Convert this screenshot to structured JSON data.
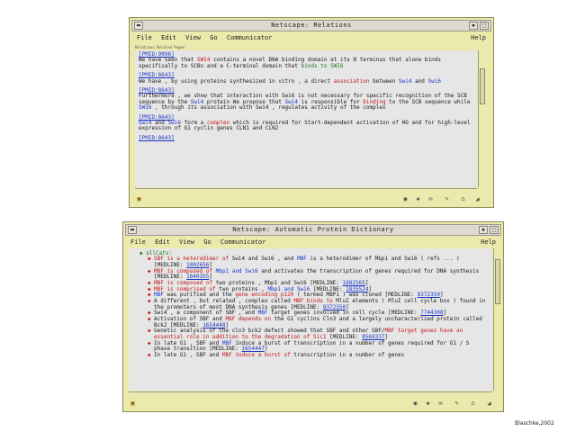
{
  "window1": {
    "title": "Netscape: Relations",
    "menu": [
      "File",
      "Edit",
      "View",
      "Go",
      "Communicator"
    ],
    "help": "Help",
    "strip": "Relations Related Pages",
    "paragraphs": [
      {
        "pmid": "[PMID:9096]",
        "segments": [
          {
            "text": "We have seen that "
          },
          {
            "text": "SWI4",
            "c": "red"
          },
          {
            "text": " contains a novel DNA binding domain at its N terminus that alone binds specifically to SCBs and a C-terminal domain that "
          },
          {
            "text": "binds to SWI6",
            "c": "green"
          }
        ]
      },
      {
        "pmid": "[PMID:8643]",
        "segments": [
          {
            "text": "We have , by using proteins synthesized in vitro , a direct "
          },
          {
            "text": "association",
            "c": "red"
          },
          {
            "text": " between "
          },
          {
            "text": "Swi4",
            "c": "blue"
          },
          {
            "text": " and "
          },
          {
            "text": "Swi6",
            "c": "blue"
          }
        ]
      },
      {
        "pmid": "[PMID:8643]",
        "segments": [
          {
            "text": "Furthermore , we show that interaction with Swi6 is not necessary for specific recognition of the SCB sequence by the "
          },
          {
            "text": "Swi4",
            "c": "blue"
          },
          {
            "text": " protein We propose that "
          },
          {
            "text": "Swi4",
            "c": "blue"
          },
          {
            "text": " is responsible for "
          },
          {
            "text": "binding",
            "c": "red"
          },
          {
            "text": " to the SCB sequence while "
          },
          {
            "text": "SWI6",
            "c": "blue"
          },
          {
            "text": " , through its association with Swi4 , regulates activity of the complex"
          }
        ]
      },
      {
        "pmid": "[PMID:8643]",
        "segments": [
          {
            "text": "Swi4",
            "c": "blue"
          },
          {
            "text": " and "
          },
          {
            "text": "Swi6",
            "c": "blue"
          },
          {
            "text": " form a "
          },
          {
            "text": "complex",
            "c": "red"
          },
          {
            "text": " which is required for Start-dependent activation of HO and for high-level expression of G1 cyclin genes CLN1 and CLN2"
          }
        ]
      },
      {
        "pmid": "[PMID:8643]",
        "segments": [
          {
            "text": ""
          }
        ]
      }
    ]
  },
  "window2": {
    "title": "Netscape: Automatic Protein Dictionary",
    "menu": [
      "File",
      "Edit",
      "View",
      "Go",
      "Communicator"
    ],
    "help": "Help",
    "root_label": "allCats:",
    "entries": [
      {
        "segments": [
          {
            "text": "SBF is a heterodimer of",
            "c": "red"
          },
          {
            "text": " Swi4 and Swi6 , and "
          },
          {
            "text": "MBF",
            "c": "blue"
          },
          {
            "text": " is a heterodimer of Mbp1 and Swi6 ( refs ... ) [MEDLINE: "
          },
          {
            "text": "1802656",
            "c": "pid"
          },
          {
            "text": "]"
          }
        ]
      },
      {
        "segments": [
          {
            "text": "MBF is composed of",
            "c": "red"
          },
          {
            "text": " Mbp1 and Swi6",
            "c": "blue"
          },
          {
            "text": " and activates the transcription of genes required for DNA synthesis [MEDLINE: "
          },
          {
            "text": "1840355",
            "c": "pid"
          },
          {
            "text": "]"
          }
        ]
      },
      {
        "segments": [
          {
            "text": "MBF is composed of",
            "c": "red"
          },
          {
            "text": " two proteins , Mbp1 and Swi6 [MEDLINE: "
          },
          {
            "text": "1882565",
            "c": "pid"
          },
          {
            "text": "]"
          }
        ]
      },
      {
        "segments": [
          {
            "text": "MBF is comprised of",
            "c": "red"
          },
          {
            "text": " two proteins , "
          },
          {
            "text": "Mbp1 and Swi6",
            "c": "blue"
          },
          {
            "text": " [MEDLINE: "
          },
          {
            "text": "1835524",
            "c": "pid"
          },
          {
            "text": "]"
          }
        ]
      },
      {
        "segments": [
          {
            "text": "MBF",
            "c": "blue"
          },
          {
            "text": " was purified and the "
          },
          {
            "text": "gene encoding p120",
            "c": "red"
          },
          {
            "text": " ( termed MBP1 ) was cloned [MEDLINE: "
          },
          {
            "text": "8372350",
            "c": "pid"
          },
          {
            "text": "]"
          }
        ]
      },
      {
        "segments": [
          {
            "text": "A different , but related , complex called "
          },
          {
            "text": "MBF binds to",
            "c": "red"
          },
          {
            "text": " MluI elements ( MluI cell cycle box ) found in the promoters of most DNA synthesis genes [MEDLINE: "
          },
          {
            "text": "8372350",
            "c": "pid"
          },
          {
            "text": "]"
          }
        ]
      },
      {
        "segments": [
          {
            "text": "Swi4 , a component of SBF , and "
          },
          {
            "text": "MBF",
            "c": "blue"
          },
          {
            "text": " target genes involved in cell cycle [MEDLINE: "
          },
          {
            "text": "7744308",
            "c": "pid"
          },
          {
            "text": "]"
          }
        ]
      },
      {
        "segments": [
          {
            "text": "Activation of SBF and "
          },
          {
            "text": "MBF depends on",
            "c": "red"
          },
          {
            "text": " the G1 cyclins Cln3 and a largely uncharacterized protein called Bck2 [MEDLINE: "
          },
          {
            "text": "1654448",
            "c": "pid"
          },
          {
            "text": "]"
          }
        ]
      },
      {
        "segments": [
          {
            "text": "Genetic analysis of the cln3 bck2 defect showed that SBF and other SBF/"
          },
          {
            "text": "MBF target genes have an essential role in addition to the degradation of Sic1",
            "c": "red"
          },
          {
            "text": " [MEDLINE: "
          },
          {
            "text": "8569337",
            "c": "pid"
          },
          {
            "text": "]"
          }
        ]
      },
      {
        "segments": [
          {
            "text": "In late G1 , SBF and "
          },
          {
            "text": "MBF",
            "c": "blue"
          },
          {
            "text": " induce a burst of transcription in a number of genes required for G1 / S phase transition [MEDLINE: "
          },
          {
            "text": "1654447",
            "c": "pid"
          },
          {
            "text": "]"
          }
        ]
      },
      {
        "segments": [
          {
            "text": "In late G1 , SBF and "
          },
          {
            "text": "MBF induce a burst of",
            "c": "red"
          },
          {
            "text": " transcription in a number of genes"
          }
        ]
      }
    ]
  },
  "credit": "Blaschke,2002",
  "colors": {
    "window_bg": "#ece9ad",
    "content_bg": "#e6e6e6",
    "link_blue": "#1a36c8",
    "highlight_red": "#c41818",
    "relation_green": "#1a7a1a"
  }
}
